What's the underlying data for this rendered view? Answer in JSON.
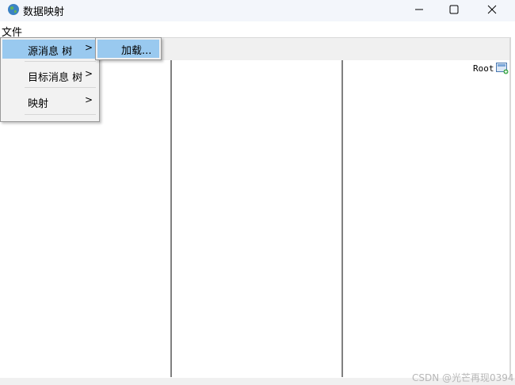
{
  "window": {
    "title": "数据映射",
    "icon": "globe-icon"
  },
  "menubar": {
    "file_label": "文件"
  },
  "file_menu": {
    "items": [
      {
        "label": "源消息 树",
        "arrow": ">"
      },
      {
        "label": "目标消息 树",
        "arrow": ">"
      },
      {
        "label": "映射",
        "arrow": ">"
      }
    ],
    "highlight_color": "#99c9ef"
  },
  "submenu": {
    "items": [
      {
        "label": "加载..."
      }
    ]
  },
  "panel_right": {
    "root_label": "Root",
    "root_icon": "tree-node-icon"
  },
  "watermark": "CSDN @光芒再现0394"
}
